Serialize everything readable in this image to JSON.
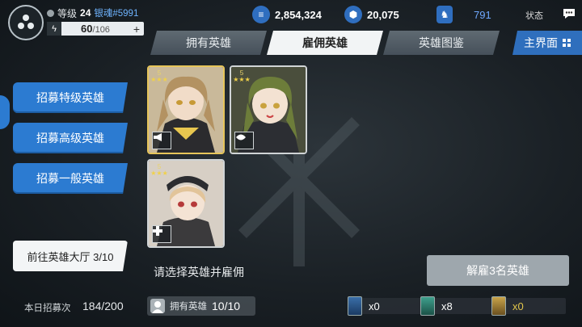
{
  "player": {
    "level_label": "等级",
    "level": "24",
    "name": "银魂#5991",
    "stamina_current": "60",
    "stamina_max": "/106",
    "stamina_plus": "+"
  },
  "resources": {
    "gold": "2,854,324",
    "gems": "20,075",
    "medals": "791",
    "status_label": "状态"
  },
  "tabs": [
    {
      "label": "拥有英雄"
    },
    {
      "label": "雇佣英雄"
    },
    {
      "label": "英雄图鉴"
    }
  ],
  "main_menu": "主界面",
  "recruit_buttons": [
    {
      "label": "招募特级英雄"
    },
    {
      "label": "招募高级英雄"
    },
    {
      "label": "招募一般英雄"
    }
  ],
  "goto_hall": "前往英雄大厅 3/10",
  "cards": [
    {
      "rank": "5",
      "stars": "★★★"
    },
    {
      "rank": "5",
      "stars": "★★★"
    },
    {
      "rank": "5",
      "stars": "★★★"
    }
  ],
  "hint": "请选择英雄并雇佣",
  "dismiss_button": "解雇3名英雄",
  "bottom": {
    "daily_label": "本日招募次",
    "daily_value": "184/200",
    "own_label": "拥有英雄",
    "own_value": "10/10",
    "items": [
      {
        "count": "x0"
      },
      {
        "count": "x8"
      },
      {
        "count": "x0"
      }
    ]
  },
  "colors": {
    "accent_blue": "#2c7bd1",
    "card_gold": "#e6c55a",
    "player_name": "#6fb4ff"
  }
}
